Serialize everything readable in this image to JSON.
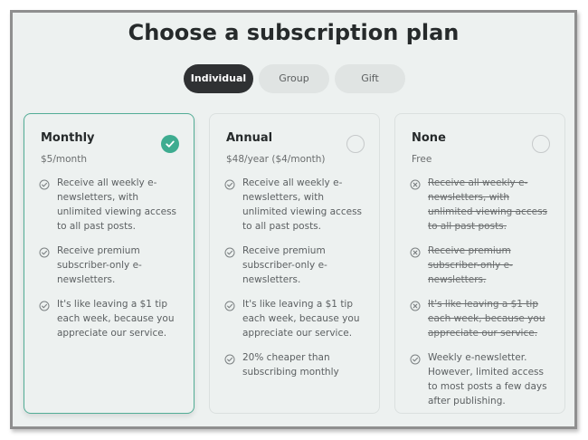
{
  "page": {
    "title": "Choose a subscription plan"
  },
  "tabs": [
    {
      "label": "Individual",
      "active": true
    },
    {
      "label": "Group",
      "active": false
    },
    {
      "label": "Gift",
      "active": false
    }
  ],
  "plans": [
    {
      "name": "Monthly",
      "price": "$5/month",
      "selected": true,
      "features": [
        {
          "text": "Receive all weekly e-newsletters, with unlimited viewing access to all past posts.",
          "included": true
        },
        {
          "text": "Receive premium subscriber-only e-newsletters.",
          "included": true
        },
        {
          "text": "It's like leaving a $1 tip each week, because you appreciate our service.",
          "included": true
        }
      ]
    },
    {
      "name": "Annual",
      "price": "$48/year ($4/month)",
      "selected": false,
      "features": [
        {
          "text": "Receive all weekly e-newsletters, with unlimited viewing access to all past posts.",
          "included": true
        },
        {
          "text": "Receive premium subscriber-only e-newsletters.",
          "included": true
        },
        {
          "text": "It's like leaving a $1 tip each week, because you appreciate our service.",
          "included": true
        },
        {
          "text": "20% cheaper than subscribing monthly",
          "included": true
        }
      ]
    },
    {
      "name": "None",
      "price": "Free",
      "selected": false,
      "features": [
        {
          "text": "Receive all weekly e-newsletters, with unlimited viewing access to all past posts.",
          "included": false
        },
        {
          "text": "Receive premium subscriber-only e-newsletters.",
          "included": false
        },
        {
          "text": "It's like leaving a $1 tip each week, because you appreciate our service.",
          "included": false
        },
        {
          "text": "Weekly e-newsletter. However, limited access to most posts a few days after publishing.",
          "included": true
        }
      ]
    }
  ],
  "icons": {
    "included": "check-circle-icon",
    "excluded": "x-circle-icon",
    "selected": "selected-check-icon",
    "unselected": "radio-empty-icon"
  },
  "colors": {
    "accent": "#3eac90",
    "selected_border": "#52ad96",
    "active_tab": "#2f3133",
    "inactive_tab": "#e0e4e3",
    "panel_background": "#edf1f0",
    "title_text": "#262a2b"
  }
}
